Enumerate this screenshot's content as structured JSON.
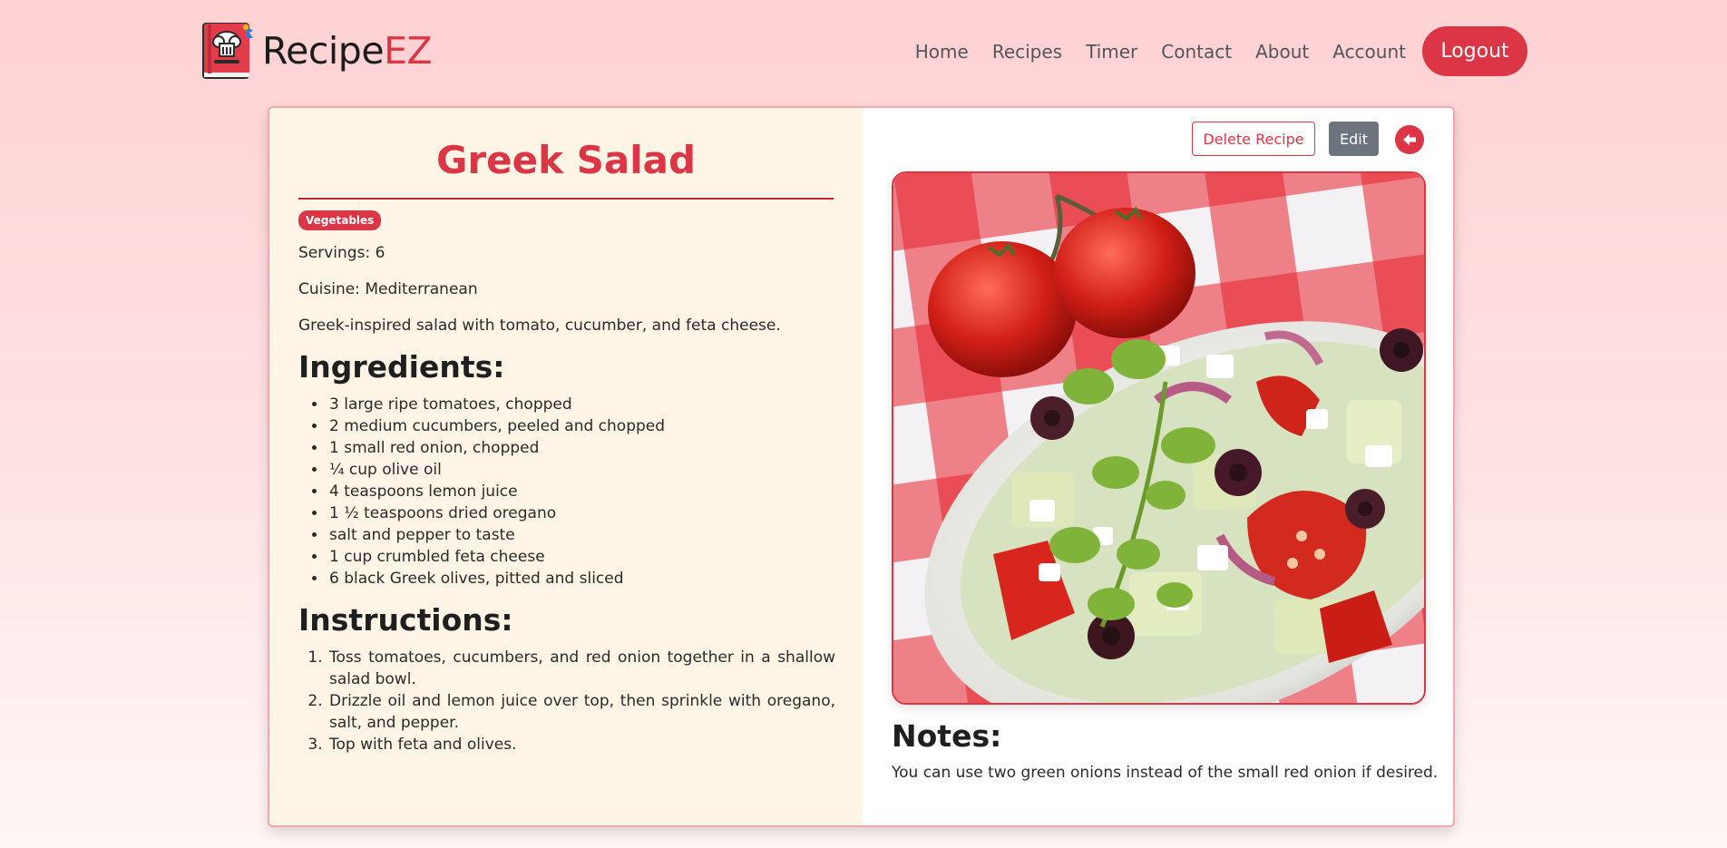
{
  "brand": {
    "name_main": "Recipe",
    "name_accent": "EZ",
    "accent_color": "#dc3545"
  },
  "nav": {
    "links": [
      "Home",
      "Recipes",
      "Timer",
      "Contact",
      "About",
      "Account"
    ],
    "logout_label": "Logout"
  },
  "recipe": {
    "title": "Greek Salad",
    "category_badge": "Vegetables",
    "servings": "Servings: 6",
    "cuisine": "Cuisine: Mediterranean",
    "description": "Greek-inspired salad with tomato, cucumber, and feta cheese.",
    "ingredients_heading": "Ingredients:",
    "ingredients": [
      "3 large ripe tomatoes, chopped",
      "2 medium cucumbers, peeled and chopped",
      "1 small red onion, chopped",
      "¼ cup olive oil",
      "4 teaspoons lemon juice",
      "1 ½ teaspoons dried oregano",
      "salt and pepper to taste",
      "1 cup crumbled feta cheese",
      "6 black Greek olives, pitted and sliced"
    ],
    "instructions_heading": "Instructions:",
    "instructions": [
      "Toss tomatoes, cucumbers, and red onion together in a shallow salad bowl.",
      "Drizzle oil and lemon juice over top, then sprinkle with oregano, salt, and pepper.",
      "Top with feta and olives."
    ],
    "notes_heading": "Notes:",
    "notes": "You can use two green onions instead of the small red onion if desired."
  },
  "actions": {
    "delete_label": "Delete Recipe",
    "edit_label": "Edit",
    "back_icon": "arrow-left-circle-icon"
  },
  "colors": {
    "primary": "#dc3545",
    "secondary": "#6c757d",
    "left_panel_bg": "#fff5e6"
  }
}
